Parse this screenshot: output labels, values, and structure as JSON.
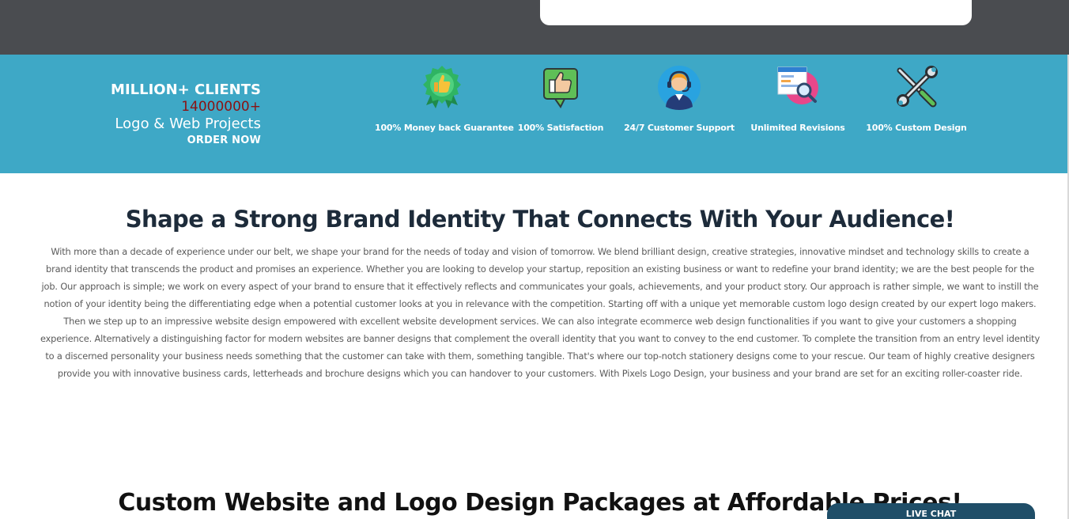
{
  "stats": {
    "clients_label": "MILLION+ CLIENTS",
    "projects_count": "14000000+",
    "projects_label": "Logo & Web Projects",
    "cta_label": "ORDER NOW"
  },
  "features": [
    {
      "label": "100% Money back Guarantee",
      "icon": "award-badge-icon"
    },
    {
      "label": "100% Satisfaction",
      "icon": "thumbs-up-icon"
    },
    {
      "label": "24/7 Customer Support",
      "icon": "headset-agent-icon"
    },
    {
      "label": "Unlimited Revisions",
      "icon": "browser-magnifier-icon"
    },
    {
      "label": "100% Custom Design",
      "icon": "wrench-screwdriver-icon"
    }
  ],
  "brand_section": {
    "title": "Shape a Strong Brand Identity That Connects With Your Audience!",
    "body": "With more than a decade of experience under our belt, we shape your brand for the needs of today and vision of tomorrow. We blend brilliant design, creative strategies, innovative mindset and technology skills to create a brand identity that transcends the product and promises an experience. Whether you are looking to develop your startup, reposition an existing business or want to redefine your brand identity; we are the best people for the job. Our approach is simple; we work on every aspect of your brand to ensure that it effectively reflects and communicates your goals, achievements, and your product story. Our approach is rather simple, we want to instill the notion of your identity being the differentiating edge when a potential customer looks at you in relevance with the competition. Starting off with a unique yet memorable custom logo design created by our expert logo makers. Then we step up to an impressive website design empowered with excellent website development services. We can also integrate ecommerce web design functionalities if you want to give your customers a shopping experience. Alternatively a distinguishing factor for modern websites are banner designs that complement the overall identity that you want to convey to the end customer. To complete the transition from an entry level identity to a discerned personality your business needs something that the customer can take with them, something tangible. That's where our top-notch stationery designs come to your rescue. Our team of highly creative designers provide you with innovative business cards, letterheads and brochure designs which you can handover to your customers. With Pixels Logo Design, your business and your brand are set for an exciting roller-coaster ride."
  },
  "packages_section": {
    "title": "Custom Website and Logo Design Packages at Affordable Prices!"
  },
  "live_chat": {
    "label": "LIVE CHAT"
  },
  "colors": {
    "top_strip": "#4a4c50",
    "band": "#3ea8c6",
    "projects_count": "#8b1212",
    "headline": "#1d2b3a",
    "live_chat": "#1f4e68"
  }
}
